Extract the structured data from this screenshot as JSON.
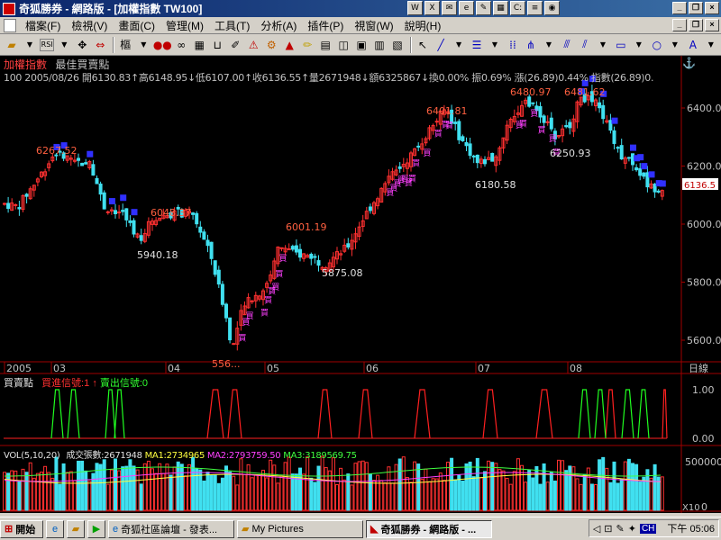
{
  "window": {
    "title": "奇狐勝券 - 網路版 - [加權指數 TW100]"
  },
  "menu": [
    {
      "label": "檔案(F)"
    },
    {
      "label": "檢視(V)"
    },
    {
      "label": "畫面(C)"
    },
    {
      "label": "管理(M)"
    },
    {
      "label": "工具(T)"
    },
    {
      "label": "分析(A)"
    },
    {
      "label": "插件(P)"
    },
    {
      "label": "視窗(W)"
    },
    {
      "label": "說明(H)"
    }
  ],
  "toolbar": {
    "draw_label": "樞",
    "rsi_label": "RSI"
  },
  "chart": {
    "name": "加權指數",
    "subtitle": "最佳買賣點",
    "info_line": "100 2005/08/26 開6130.83↑高6148.95↓低6107.00↑收6136.55↑量2671948↓額6325867↓換0.00% 振0.69% 漲(26.89)0.44% 指數(26.89)0."
  },
  "price_panel": {
    "y_ticks": [
      "6400.0",
      "6200.0",
      "6000.0",
      "5800.0",
      "5600.0"
    ],
    "current_price": "6136.5",
    "annotations": [
      {
        "text": "6267.52"
      },
      {
        "text": "6048.37"
      },
      {
        "text": "5940.18"
      },
      {
        "text": "6001.19"
      },
      {
        "text": "5875.08"
      },
      {
        "text": "556..."
      },
      {
        "text": "6401.81"
      },
      {
        "text": "6180.58"
      },
      {
        "text": "6480.97"
      },
      {
        "text": "6481.62"
      },
      {
        "text": "6250.93"
      }
    ],
    "x_labels": [
      "2005",
      "03",
      "04",
      "05",
      "06",
      "07",
      "08"
    ],
    "x_unit": "日線"
  },
  "signal_panel": {
    "title": "買賣點",
    "buy_label": "買進信號:1",
    "sell_label": "賣出信號:0",
    "y_ticks": [
      "1.00",
      "0.00"
    ]
  },
  "volume_panel": {
    "title": "VOL(5,10,20)",
    "volume_label": "成交張數:2671948",
    "ma1": "MA1:2734965",
    "ma2": "MA2:2793759.50",
    "ma3": "MA3:3189569.75",
    "y_ticks": [
      "500000",
      "0"
    ],
    "x_unit": "X10"
  },
  "taskbar": {
    "start_label": "開始",
    "tasks": [
      {
        "label": "奇狐社區論壇 - 發表..."
      },
      {
        "label": "My Pictures"
      },
      {
        "label": "奇狐勝券 - 網路版 - ..."
      }
    ],
    "lang": "CH",
    "clock": "下午 05:06"
  },
  "colors": {
    "up": "#ff3030",
    "down": "#40e0f0",
    "buy": "#ff40ff",
    "sell": "#3030ff",
    "signal_buy": "#ff2020",
    "signal_sell": "#20ff20"
  }
}
